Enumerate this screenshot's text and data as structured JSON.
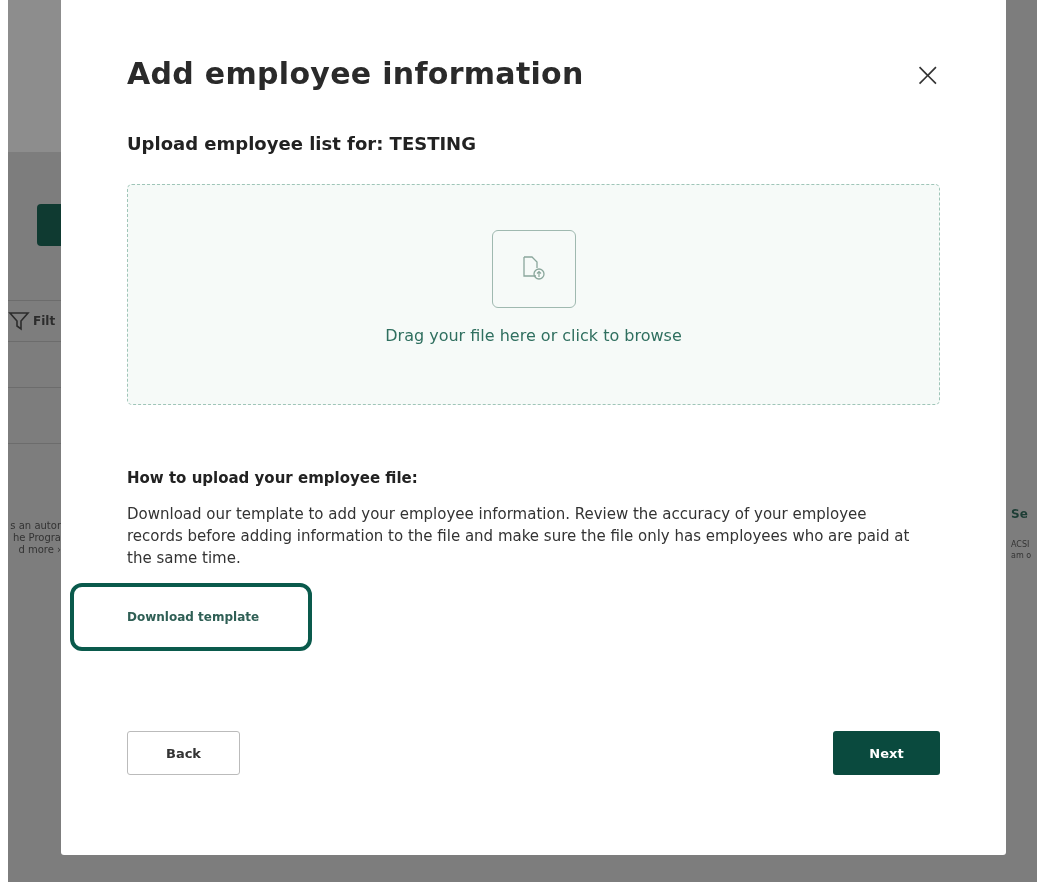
{
  "background": {
    "left": {
      "filter_label": "Filt",
      "text_lines": [
        "s an autor",
        "he Progra",
        "d more ›"
      ]
    },
    "right": {
      "link": "Se",
      "text_lines": [
        "ACSI",
        "am o"
      ]
    }
  },
  "modal": {
    "title": "Add employee information",
    "close": "×",
    "subtitle": "Upload employee list for: TESTING",
    "dropzone": {
      "text": "Drag your file here or click to browse"
    },
    "instructions": {
      "heading": "How to upload your employee file:",
      "body": "Download our template to add your employee information. Review the accuracy of your employee records before adding information to the file and make sure the file only has employees who are paid at the same time."
    },
    "template_link": {
      "label": "Download template",
      "highlighted": true
    },
    "buttons": [
      {
        "label": "Back",
        "kind": "secondary"
      },
      {
        "label": "Next",
        "kind": "primary"
      }
    ]
  }
}
